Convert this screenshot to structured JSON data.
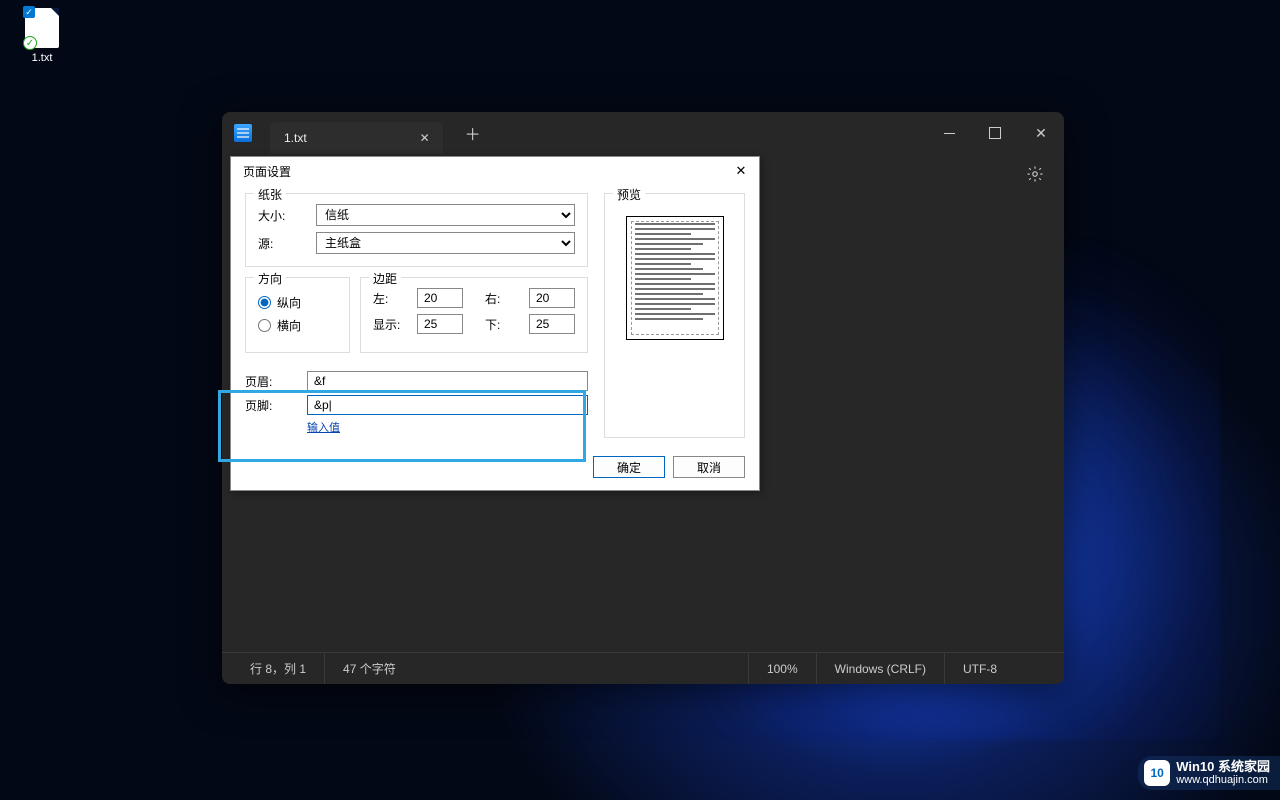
{
  "desktop": {
    "file_name": "1.txt"
  },
  "notepad": {
    "tab_label": "1.txt",
    "menu": {
      "settings": "设置"
    }
  },
  "statusbar": {
    "cursor": "行 8，列 1",
    "chars": "47 个字符",
    "zoom": "100%",
    "eol": "Windows (CRLF)",
    "encoding": "UTF-8"
  },
  "dialog": {
    "title": "页面设置",
    "paper": {
      "legend": "纸张",
      "size_label": "大小:",
      "size_value": "信纸",
      "source_label": "源:",
      "source_value": "主纸盒"
    },
    "orientation": {
      "legend": "方向",
      "portrait": "纵向",
      "landscape": "横向",
      "selected": "portrait"
    },
    "margins": {
      "legend": "边距",
      "left_label": "左:",
      "left_value": "20",
      "right_label": "右:",
      "right_value": "20",
      "show_label": "显示:",
      "show_value": "25",
      "bottom_label": "下:",
      "bottom_value": "25"
    },
    "header_label": "页眉:",
    "header_value": "&f",
    "footer_label": "页脚:",
    "footer_value": "&p|",
    "help_link": "输入值",
    "preview_legend": "预览",
    "ok": "确定",
    "cancel": "取消"
  },
  "watermark": {
    "brand": "Win10",
    "suffix": "系统家园",
    "url": "www.qdhuajin.com"
  }
}
